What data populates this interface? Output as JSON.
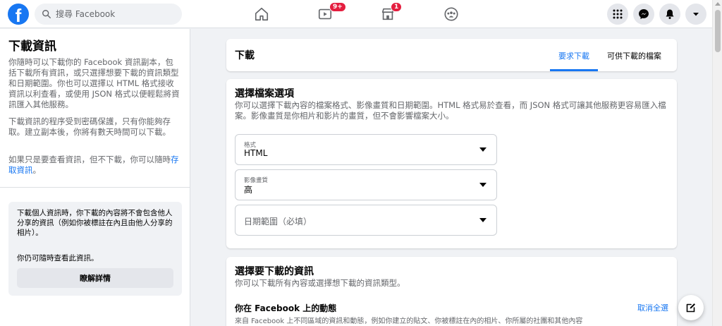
{
  "topbar": {
    "logo_letter": "f",
    "search_placeholder": "搜尋 Facebook",
    "nav": {
      "home": {
        "icon": "home-icon"
      },
      "watch": {
        "icon": "video-icon",
        "badge": "9+"
      },
      "marketplace": {
        "icon": "store-icon",
        "badge": "1"
      },
      "groups": {
        "icon": "groups-icon"
      }
    },
    "actions": [
      "menu-grid-icon",
      "messenger-icon",
      "bell-icon",
      "chevron-down-icon"
    ]
  },
  "sidebar": {
    "title": "下載資訊",
    "intro": "你隨時可以下載你的 Facebook 資訊副本，包括下載所有資訊，或只選擇想要下載的資訊類型和日期範圍。你也可以選擇以 HTML 格式接收資訊以利查看，或使用 JSON 格式以便輕鬆將資訊匯入其他服務。",
    "protection": "下載資訊的程序受到密碼保護，只有你能夠存取。建立副本後，你將有數天時間可以下載。",
    "view_prefix": "如果只是要查看資訊，但不下載，你可以隨時",
    "view_link": "存取資訊",
    "view_suffix": "。",
    "info_box": {
      "text1": "下載個人資訊時，你下載的內容將不會包含他人分享的資訊（例如你被標註在內且由他人分享的相片）。",
      "text2": "你仍可隨時查看此資訊。",
      "button": "瞭解詳情"
    }
  },
  "header": {
    "title": "下載",
    "tabs": [
      {
        "label": "要求下載",
        "active": true
      },
      {
        "label": "可供下載的檔案",
        "active": false
      }
    ]
  },
  "options": {
    "title": "選擇檔案選項",
    "description": "你可以選擇下載內容的檔案格式、影像畫質和日期範圍。HTML 格式易於查看，而 JSON 格式可讓其他服務更容易匯入檔案。影像畫質是你相片和影片的畫質，但不會影響檔案大小。",
    "format": {
      "label": "格式",
      "value": "HTML"
    },
    "quality": {
      "label": "影像畫質",
      "value": "高"
    },
    "date_range": {
      "placeholder": "日期範圍（必填）"
    }
  },
  "download": {
    "title": "選擇要下載的資訊",
    "description": "你可以下載所有內容或選擇想下載的資訊類型。",
    "section": {
      "title": "你在 Facebook 上的動態",
      "deselect": "取消全選",
      "description": "來自 Facebook 上不同區域的資訊和動態，例如你建立的貼文、你被標註在內的相片、你所屬的社團和其他內容"
    }
  },
  "colors": {
    "brand": "#1877f2",
    "badge": "#e41e3f",
    "background": "#f0f2f5"
  }
}
